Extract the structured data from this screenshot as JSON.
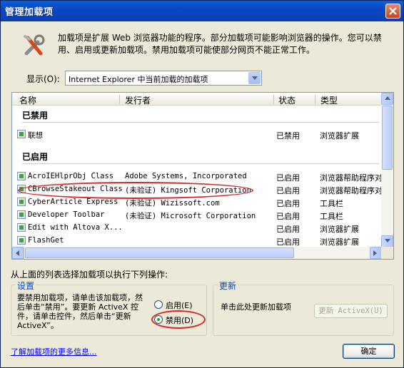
{
  "window": {
    "title": "管理加载项"
  },
  "header": {
    "description": "加载项是扩展 Web 浏览器功能的程序。部分加载项可能影响浏览器的操作。您可以禁用、启用或更新加载项。禁用加载项可能使部分网页不能正常工作。"
  },
  "show": {
    "label": "显示(O):",
    "selected": "Internet Explorer 中当前加载的加载项"
  },
  "list": {
    "columns": [
      "名称",
      "发行者",
      "状态",
      "类型"
    ],
    "groups": [
      {
        "title": "已禁用",
        "rows": [
          {
            "name": "联想",
            "publisher": "",
            "status": "已禁用",
            "type": "浏览器扩展"
          }
        ]
      },
      {
        "title": "已启用",
        "rows": [
          {
            "name": "AcroIEHlprObj Class",
            "publisher": "Adobe Systems, Incorporated",
            "status": "已启用",
            "type": "浏览器帮助程序对"
          },
          {
            "name": "CBrowseStakeout Class",
            "publisher": "(未验证) Kingsoft Corporation",
            "status": "已启用",
            "type": "浏览器帮助程序对"
          },
          {
            "name": "CyberArticle Express",
            "publisher": "(未验证) Wizissoft.com",
            "status": "已启用",
            "type": "工具栏"
          },
          {
            "name": "Developer Toolbar",
            "publisher": "(未验证) Microsoft Corporation",
            "status": "已启用",
            "type": "工具栏"
          },
          {
            "name": "Edit with Altova X...",
            "publisher": "",
            "status": "已启用",
            "type": "浏览器扩展"
          },
          {
            "name": "FlashGet",
            "publisher": "",
            "status": "已启用",
            "type": "浏览器扩展"
          }
        ]
      }
    ]
  },
  "actions_label": "从上面的列表选择加载项以执行下列操作:",
  "settings": {
    "title": "设置",
    "text": "要禁用加载项，请单击该加载项，然后单击“禁用”。要更新 ActiveX 控件，请单击控件，然后单击“更新 ActiveX”。",
    "enable_label": "启用(E)",
    "disable_label": "禁用(D)",
    "selected": "disable"
  },
  "update": {
    "title": "更新",
    "text": "单击此处更新加载项",
    "button_label": "更新 ActiveX(U)"
  },
  "footer": {
    "learn_more": "了解加载项的更多信息...",
    "ok_label": "确定"
  },
  "colors": {
    "titlebar": "#0A5FDA",
    "highlight_ring": "#D62828",
    "link": "#0000FF",
    "group_title": "#0046D5"
  }
}
